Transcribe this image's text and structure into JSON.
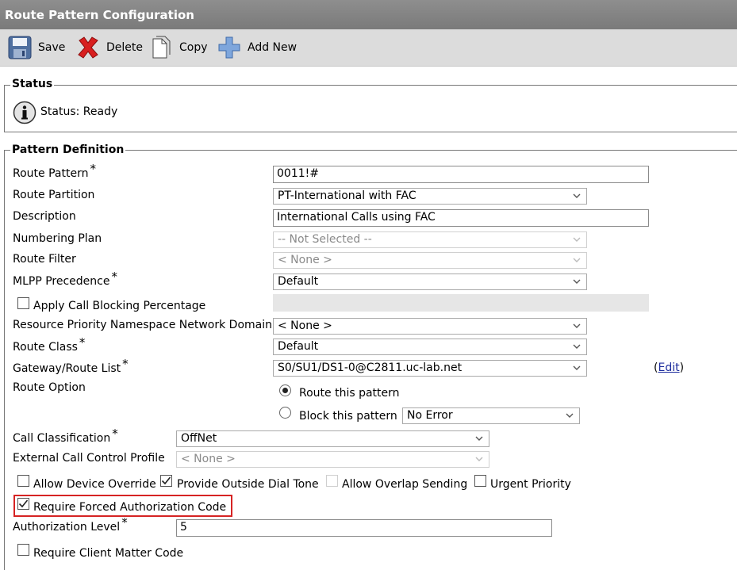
{
  "window": {
    "title": "Route Pattern Configuration"
  },
  "toolbar": {
    "save": "Save",
    "delete": "Delete",
    "copy": "Copy",
    "add_new": "Add New"
  },
  "status": {
    "legend": "Status",
    "text": "Status: Ready"
  },
  "pattern": {
    "legend": "Pattern Definition",
    "route_pattern": {
      "label": "Route Pattern",
      "value": "0011!#"
    },
    "route_partition": {
      "label": "Route Partition",
      "value": "PT-International with FAC"
    },
    "description": {
      "label": "Description",
      "value": "International Calls using FAC"
    },
    "numbering_plan": {
      "label": "Numbering Plan",
      "value": "-- Not Selected --"
    },
    "route_filter": {
      "label": "Route Filter",
      "value": "< None >"
    },
    "mlpp": {
      "label": "MLPP Precedence",
      "value": "Default"
    },
    "apply_call_blocking": {
      "label": "Apply Call Blocking Percentage",
      "checked": false
    },
    "rpn_domain": {
      "label": "Resource Priority Namespace Network Domain",
      "value": "< None >"
    },
    "route_class": {
      "label": "Route Class",
      "value": "Default"
    },
    "gateway": {
      "label": "Gateway/Route List",
      "value": "S0/SU1/DS1-0@C2811.uc-lab.net",
      "edit_open": "(",
      "edit": "Edit",
      "edit_close": ")"
    },
    "route_option": {
      "label": "Route Option",
      "route_this": "Route this pattern",
      "block_this": "Block this pattern",
      "block_reason": "No Error",
      "selected": "Route this pattern"
    },
    "call_classification": {
      "label": "Call Classification",
      "value": "OffNet"
    },
    "ext_call_control": {
      "label": "External Call Control Profile",
      "value": "< None >"
    },
    "allow_device_override": {
      "label": "Allow Device Override",
      "checked": false
    },
    "provide_outside_dial_tone": {
      "label": "Provide Outside Dial Tone",
      "checked": true
    },
    "allow_overlap_sending": {
      "label": "Allow Overlap Sending",
      "checked": false
    },
    "urgent_priority": {
      "label": "Urgent Priority",
      "checked": false
    },
    "require_fac": {
      "label": "Require Forced Authorization Code",
      "checked": true
    },
    "auth_level": {
      "label": "Authorization Level",
      "value": "5"
    },
    "require_cmc": {
      "label": "Require Client Matter Code",
      "checked": false
    },
    "required_mark": "*"
  },
  "colors": {
    "titlebar": "#878787",
    "toolbar": "#dcdcdc",
    "highlight": "#d62323",
    "link": "#1a2a9c"
  }
}
